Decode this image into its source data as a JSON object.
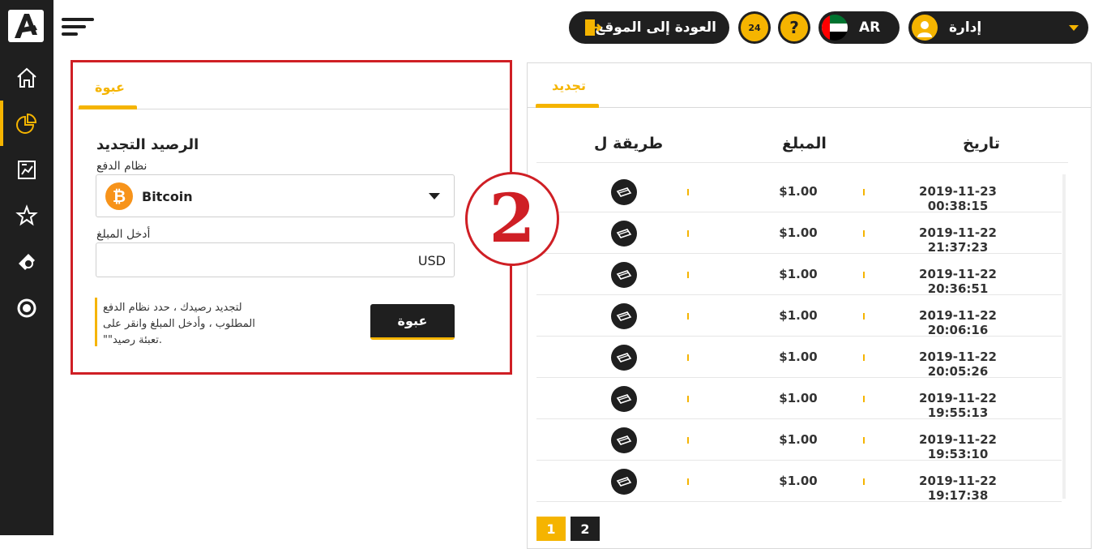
{
  "topbar": {
    "user_label": "إدارة",
    "lang_label": "AR",
    "help_label": "?",
    "support_label": "24",
    "back_label": "العودة إلى الموقع"
  },
  "deposit_panel": {
    "tab_label": "عبوة",
    "title": "الرصيد التجديد",
    "payment_system_label": "نظام الدفع",
    "payment_system_value": "Bitcoin",
    "amount_label": "أدخل المبلغ",
    "currency": "USD",
    "hint_lines": [
      "لتجديد رصيدك ، حدد نظام الدفع",
      "المطلوب ، وأدخل المبلغ وانقر على",
      "\"\"تعبئة رصيد."
    ],
    "submit_label": "عبوة"
  },
  "annotation": {
    "step_number": "2"
  },
  "history_panel": {
    "tab_label": "تجديد",
    "columns": {
      "date": "تاريخ",
      "amount": "المبلغ",
      "method": "طريقة ل"
    },
    "rows": [
      {
        "date": "2019-11-23 00:38:15",
        "amount": "$1.00"
      },
      {
        "date": "2019-11-22 21:37:23",
        "amount": "$1.00"
      },
      {
        "date": "2019-11-22 20:36:51",
        "amount": "$1.00"
      },
      {
        "date": "2019-11-22 20:06:16",
        "amount": "$1.00"
      },
      {
        "date": "2019-11-22 20:05:26",
        "amount": "$1.00"
      },
      {
        "date": "2019-11-22 19:55:13",
        "amount": "$1.00"
      },
      {
        "date": "2019-11-22 19:53:10",
        "amount": "$1.00"
      },
      {
        "date": "2019-11-22 19:17:38",
        "amount": "$1.00"
      }
    ],
    "pagination": [
      "1",
      "2"
    ]
  },
  "colors": {
    "accent": "#f5b400",
    "dark": "#1f1f1f",
    "annotation_red": "#cf1f25",
    "bitcoin": "#f7931a"
  },
  "sidebar_icons": [
    "home-icon",
    "pie-chart-icon",
    "report-icon",
    "star-icon",
    "bill-icon",
    "refresh-dollar-icon"
  ]
}
